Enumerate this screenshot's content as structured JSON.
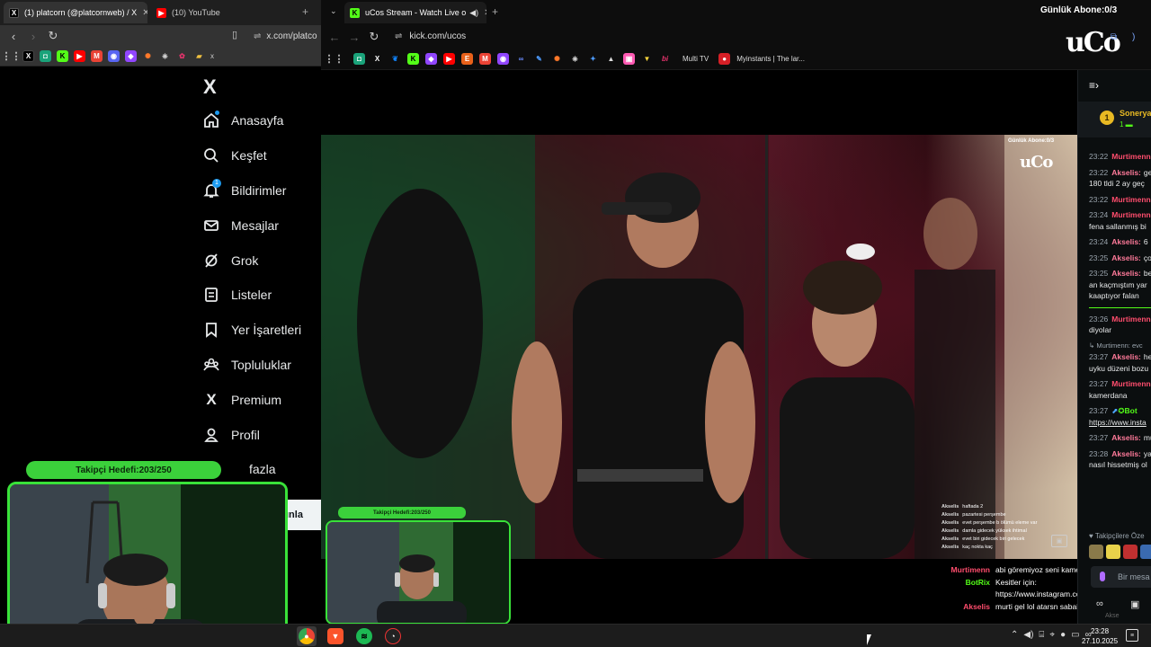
{
  "left_browser": {
    "tabs": [
      {
        "label": "(1) platcorn (@platcornweb) / X",
        "icon": "x-icon"
      },
      {
        "label": "(10) YouTube",
        "icon": "youtube-icon"
      }
    ],
    "url": "x.com/platco",
    "nav": [
      {
        "label": "Anasayfa",
        "icon": "home-icon"
      },
      {
        "label": "Keşfet",
        "icon": "search-icon"
      },
      {
        "label": "Bildirimler",
        "icon": "bell-icon",
        "badge": "1"
      },
      {
        "label": "Mesajlar",
        "icon": "mail-icon"
      },
      {
        "label": "Grok",
        "icon": "grok-icon"
      },
      {
        "label": "Listeler",
        "icon": "list-icon"
      },
      {
        "label": "Yer İşaretleri",
        "icon": "bookmark-icon"
      },
      {
        "label": "Topluluklar",
        "icon": "community-icon"
      },
      {
        "label": "Premium",
        "icon": "x-premium-icon"
      },
      {
        "label": "Profil",
        "icon": "profile-icon"
      },
      {
        "label": "fazla",
        "icon": "more-icon"
      }
    ],
    "more_button": "ınla"
  },
  "overlay_left": {
    "goal_text": "Takipçi Hedefi:203/250"
  },
  "right_browser": {
    "tab_label": "uCos Stream - Watch Live o",
    "url": "kick.com/ucos",
    "bookmarks": [
      "Multi TV",
      "Myinstants | The lar..."
    ],
    "daily_sub": "Günlük Abone:0/3",
    "logo": "uCo"
  },
  "video": {
    "daily_sub": "Günlük Abone:0/3",
    "logo": "uCo",
    "overlay_chat": [
      {
        "user": "Akselis",
        "text": "haftada 2"
      },
      {
        "user": "Akselis",
        "text": "pazartesi perşembe"
      },
      {
        "user": "Akselis",
        "text": "evet perşembe b ölümü eleme var"
      },
      {
        "user": "Akselis",
        "text": "damla gidecek yüksek ihtimal"
      },
      {
        "user": "Akselis",
        "text": "evet biri gidecek biri gelecek"
      },
      {
        "user": "Akselis",
        "text": "kaç nokta kaç"
      }
    ],
    "goal_text": "Takipçi Hedefi:203/250"
  },
  "bottom_chat": [
    {
      "user": "Murtimenn",
      "color": "#ff4d6d",
      "text": "abi göremiyoz seni kamerdana"
    },
    {
      "user": "BotRix",
      "color": "#53fc18",
      "text": "Kesitler için:"
    },
    {
      "user": "",
      "color": "#ffffff",
      "text": "https://www.instagram.com/ucos.tr"
    },
    {
      "user": "Akselis",
      "color": "#ff4d6d",
      "text": "murti gel lol atarsn sabaha kadar"
    }
  ],
  "chat_panel": {
    "pinned_name": "Sonerya",
    "pinned_rank": "1",
    "pinned_count": "1",
    "messages": [
      {
        "time": "23:22",
        "user": "Murtimenn",
        "color": "#ff4d6d",
        "text": ""
      },
      {
        "time": "23:22",
        "user": "Akselis:",
        "color": "#ff7a9a",
        "text": "ge"
      },
      {
        "time": "",
        "user": "",
        "color": "#e7e9ea",
        "text": "180 tldi 2 ay geç"
      },
      {
        "time": "23:22",
        "user": "Murtimenn",
        "color": "#ff4d6d",
        "text": ""
      },
      {
        "time": "23:24",
        "user": "Murtimenn",
        "color": "#ff4d6d",
        "text": ""
      },
      {
        "time": "",
        "user": "",
        "color": "#e7e9ea",
        "text": "fena sallanmış bi"
      },
      {
        "time": "23:24",
        "user": "Akselis:",
        "color": "#ff7a9a",
        "text": "6"
      },
      {
        "time": "23:25",
        "user": "Akselis:",
        "color": "#ff7a9a",
        "text": "ço"
      },
      {
        "time": "23:25",
        "user": "Akselis:",
        "color": "#ff7a9a",
        "text": "be"
      },
      {
        "time": "",
        "user": "",
        "color": "#e7e9ea",
        "text": "an kaçmıştım yar"
      },
      {
        "time": "",
        "user": "",
        "color": "#e7e9ea",
        "text": "kaaptıyor falan"
      },
      {
        "time": "23:26",
        "user": "Murtimenn",
        "color": "#ff4d6d",
        "text": ""
      },
      {
        "time": "",
        "user": "",
        "color": "#e7e9ea",
        "text": "diyolar"
      },
      {
        "time": "",
        "user": "Murtimenn: evc",
        "color": "#9aa4ad",
        "text": ""
      },
      {
        "time": "23:27",
        "user": "Akselis:",
        "color": "#ff7a9a",
        "text": "he"
      },
      {
        "time": "",
        "user": "",
        "color": "#e7e9ea",
        "text": "uyku düzeni bozu"
      },
      {
        "time": "23:27",
        "user": "Murtimenn",
        "color": "#ff4d6d",
        "text": ""
      },
      {
        "time": "",
        "user": "",
        "color": "#e7e9ea",
        "text": "kamerdana"
      },
      {
        "time": "23:27",
        "user": "Bot",
        "color": "#53fc18",
        "text": ""
      },
      {
        "time": "",
        "user": "",
        "color": "#e7e9ea",
        "text": "https://www.insta"
      },
      {
        "time": "23:27",
        "user": "Akselis:",
        "color": "#ff7a9a",
        "text": "mu"
      },
      {
        "time": "23:28",
        "user": "Akselis:",
        "color": "#ff7a9a",
        "text": "ya"
      },
      {
        "time": "",
        "user": "",
        "color": "#e7e9ea",
        "text": "nasıl hissetmiş ol"
      }
    ],
    "followers_label": "Takipçilere Öze",
    "input_placeholder": "Bir mesa",
    "bottom_label": "Akse"
  },
  "taskbar": {
    "time": "23:28",
    "date": "27.10.2025"
  }
}
